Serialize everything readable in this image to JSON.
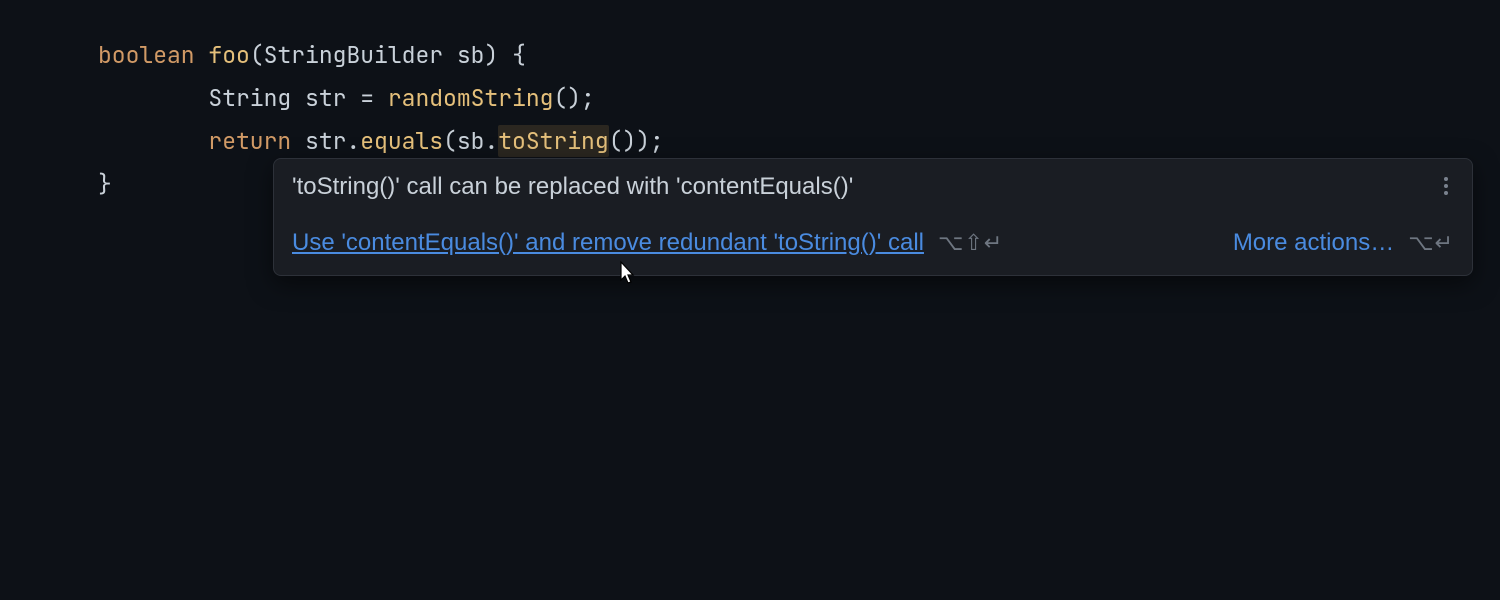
{
  "code": {
    "line1": {
      "keyword": "boolean",
      "function": "foo",
      "paramType": "StringBuilder",
      "paramName": "sb",
      "raw_after": ") {"
    },
    "line2": {
      "indent": "        ",
      "type": "String",
      "var": "str",
      "assign": " = ",
      "call": "randomString",
      "tail": "();"
    },
    "line3": {
      "indent": "        ",
      "keyword": "return",
      "prefix": " str.",
      "call1": "equals",
      "mid": "(sb.",
      "highlighted": "toString",
      "tail": "());"
    },
    "line4": {
      "text": "}"
    }
  },
  "tooltip": {
    "title": "'toString()' call can be replaced with 'contentEquals()'",
    "fix_link": "Use 'contentEquals()' and remove redundant 'toString()' call",
    "fix_shortcut": "⌥⇧↵",
    "more_actions": "More actions…",
    "more_shortcut": "⌥↵"
  }
}
